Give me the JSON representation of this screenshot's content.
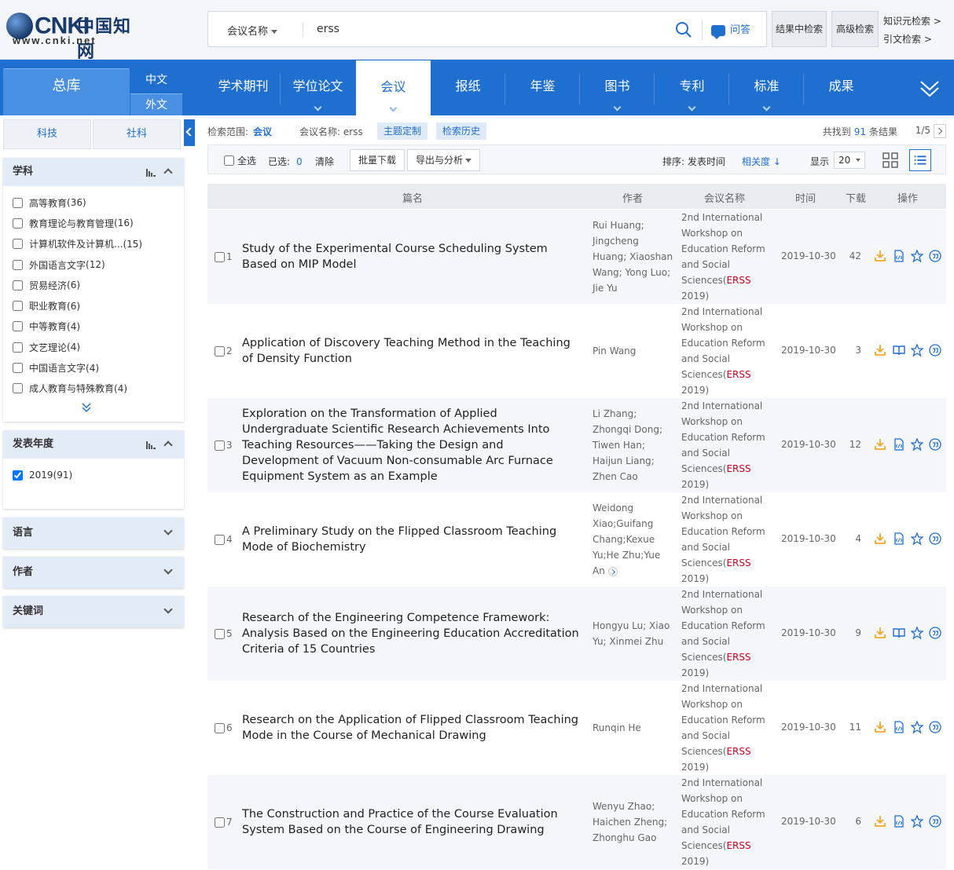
{
  "logo": {
    "brand": "CNKI",
    "zh": "中国知网",
    "url": "www.cnki.net"
  },
  "search": {
    "field": "会议名称",
    "value": "erss",
    "qa_label": "问答",
    "within_label": "结果中检索",
    "advanced_label": "高级检索",
    "link_knowledge": "知识元检索 >",
    "link_citation": "引文检索 >"
  },
  "nav": {
    "zongku": "总库",
    "zh": "中文",
    "en": "外文",
    "tabs": [
      {
        "label": "学术期刊",
        "caret": false
      },
      {
        "label": "学位论文",
        "caret": true
      },
      {
        "label": "会议",
        "caret": true
      },
      {
        "label": "报纸",
        "caret": false
      },
      {
        "label": "年鉴",
        "caret": false
      },
      {
        "label": "图书",
        "caret": true
      },
      {
        "label": "专利",
        "caret": true
      },
      {
        "label": "标准",
        "caret": true
      },
      {
        "label": "成果",
        "caret": false
      }
    ]
  },
  "sidebar": {
    "tab_tech": "科技",
    "tab_social": "社科",
    "subject": {
      "title": "学科",
      "items": [
        {
          "label": "高等教育",
          "count": "(36)"
        },
        {
          "label": "教育理论与教育管理",
          "count": "(16)"
        },
        {
          "label": "计算机软件及计算机...",
          "count": " (15)"
        },
        {
          "label": "外国语言文字",
          "count": "(12)"
        },
        {
          "label": "贸易经济",
          "count": "(6)"
        },
        {
          "label": "职业教育",
          "count": "(6)"
        },
        {
          "label": "中等教育",
          "count": "(4)"
        },
        {
          "label": "文艺理论",
          "count": "(4)"
        },
        {
          "label": "中国语言文字",
          "count": "(4)"
        },
        {
          "label": "成人教育与特殊教育",
          "count": "(4)"
        }
      ]
    },
    "year": {
      "title": "发表年度",
      "items": [
        {
          "label": "2019",
          "count": "(91)",
          "checked": true
        }
      ]
    },
    "lang": {
      "title": "语言"
    },
    "author": {
      "title": "作者"
    },
    "keyword": {
      "title": "关键词"
    }
  },
  "crumb": {
    "scope_label": "检索范围:",
    "scope_value": "会议",
    "name_label": "会议名称:",
    "name_value": "erss",
    "chip_theme": "主题定制",
    "chip_history": "检索历史",
    "total_prefix": "共找到",
    "total": "91",
    "total_suffix": "条结果",
    "page": "1/5"
  },
  "toolbar": {
    "select_all": "全选",
    "selected_label": "已选:",
    "selected_count": "0",
    "clear": "清除",
    "batch_download": "批量下载",
    "export": "导出与分析",
    "sort_label": "排序: 发表时间",
    "sort_relevance": "相关度",
    "show_label": "显示",
    "page_size": "20"
  },
  "table": {
    "headers": {
      "title": "篇名",
      "author": "作者",
      "conf": "会议名称",
      "date": "时间",
      "downloads": "下载",
      "ops": "操作"
    },
    "conf_prefix": "2nd International Workshop on Education Reform and Social Sciences(",
    "conf_hl": "ERSS",
    "conf_suffix": " 2019)",
    "rows": [
      {
        "idx": "1",
        "title": "Study of the Experimental Course Scheduling System Based on MIP Model",
        "author": "Rui Huang; Jingcheng Huang; Xiaoshan Wang; Yong Luo; Jie Yu",
        "date": "2019-10-30",
        "downloads": "42",
        "read_icon": "html"
      },
      {
        "idx": "2",
        "title": "Application of Discovery Teaching Method in the Teaching of Density Function",
        "author": "Pin Wang",
        "date": "2019-10-30",
        "downloads": "3",
        "read_icon": "book"
      },
      {
        "idx": "3",
        "title": "Exploration on the Transformation of Applied Undergraduate Scientific Research Achievements Into Teaching Resources——Taking the Design and Development of Vacuum Non-consumable Arc Furnace Equipment System as an Example",
        "author": "Li Zhang; Zhongqi Dong; Tiwen Han; Haijun Liang; Zhen Cao",
        "date": "2019-10-30",
        "downloads": "12",
        "read_icon": "html"
      },
      {
        "idx": "4",
        "title": "A Preliminary Study on the Flipped Classroom Teaching Mode of Biochemistry",
        "author": "Weidong Xiao;Guifang Chang;Kexue Yu;He Zhu;Yue An",
        "date": "2019-10-30",
        "downloads": "4",
        "read_icon": "html"
      },
      {
        "idx": "5",
        "title": "Research of the Engineering Competence Framework: Analysis Based on the Engineering Education Accreditation Criteria of 15 Countries",
        "author": "Hongyu Lu; Xiao Yu; Xinmei Zhu",
        "date": "2019-10-30",
        "downloads": "9",
        "read_icon": "book"
      },
      {
        "idx": "6",
        "title": "Research on the Application of Flipped Classroom Teaching Mode in the Course of Mechanical Drawing",
        "author": "Runqin He",
        "date": "2019-10-30",
        "downloads": "11",
        "read_icon": "html"
      },
      {
        "idx": "7",
        "title": "The Construction and Practice of the Course Evaluation System Based on the Course of Engineering Drawing",
        "author": "Wenyu Zhao; Haichen Zheng; Zhonghu Gao",
        "date": "2019-10-30",
        "downloads": "6",
        "read_icon": "html"
      }
    ]
  },
  "colors": {
    "primary": "#1f6fd0",
    "nav": "#1f6fd0",
    "highlight": "#d0021b",
    "download": "#f5a623"
  }
}
